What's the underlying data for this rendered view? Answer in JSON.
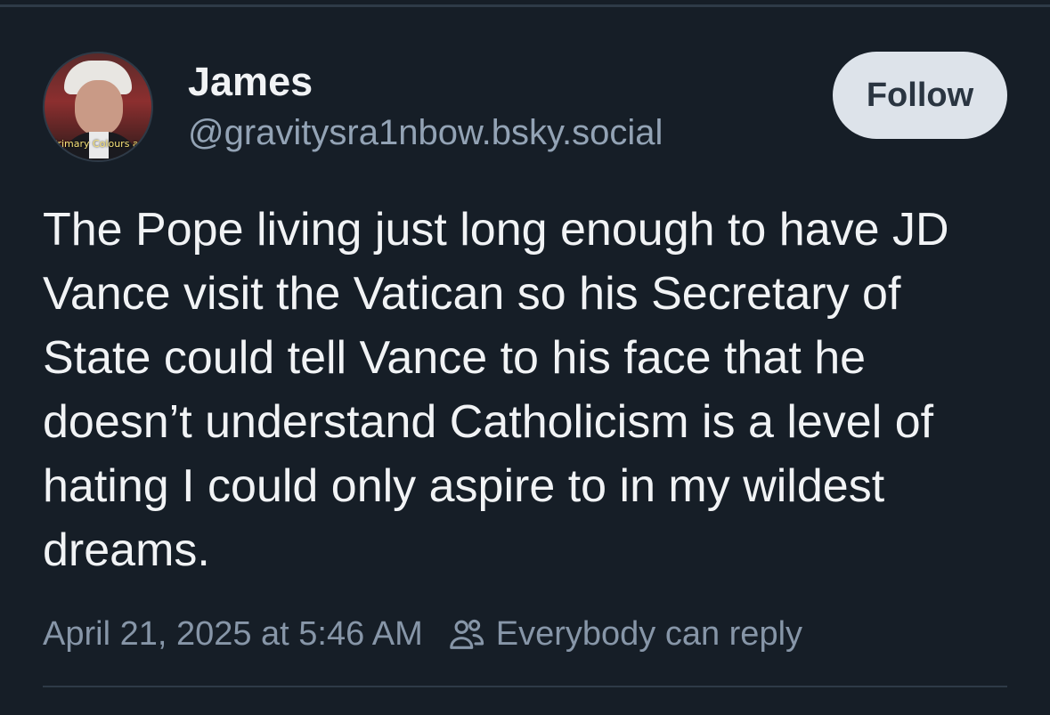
{
  "author": {
    "display_name": "James",
    "handle": "@gravitysra1nbow.bsky.social",
    "avatar_caption": "Primary Colours are"
  },
  "follow_button": {
    "label": "Follow"
  },
  "post": {
    "text": "The Pope living just long enough to have JD Vance visit the Vatican so his Secretary of State could tell Vance to his face that he doesn’t understand Catholicism is a level of hating I could only aspire to in my wildest dreams."
  },
  "meta": {
    "timestamp": "April 21, 2025 at 5:46 AM",
    "reply_setting": "Everybody can reply",
    "reply_icon": "people-icon"
  },
  "colors": {
    "background": "#161e27",
    "text": "#f1f3f5",
    "muted_text": "#8796a8",
    "follow_button_bg": "#dde3ea",
    "divider": "#2e3a47"
  }
}
